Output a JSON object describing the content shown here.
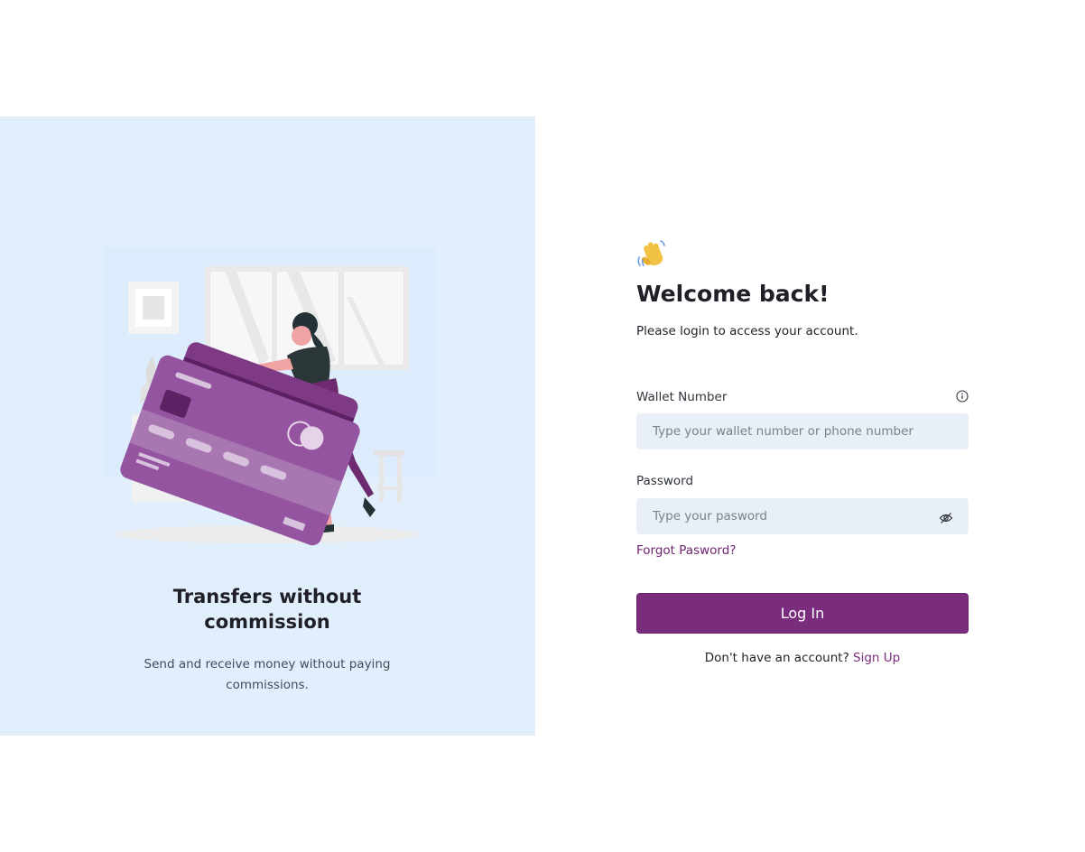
{
  "promo": {
    "title_line1": "Transfers without",
    "title_line2": "commission",
    "text_line1": "Send and receive money without paying",
    "text_line2": "commissions."
  },
  "login": {
    "icon": "waving-hand-icon",
    "title": "Welcome back!",
    "subtitle": "Please login to access your account.",
    "wallet_label": "Wallet Number",
    "wallet_placeholder": "Type your wallet number or phone number",
    "wallet_value": "",
    "password_label": "Password",
    "password_placeholder": "Type your pasword",
    "password_value": "",
    "forgot_label": "Forgot Pasword?",
    "login_button": "Log In",
    "signup_prompt": "Don't have an account?",
    "signup_link": "Sign Up"
  },
  "icons": {
    "info": "info-icon",
    "password_toggle": "eye-slash-icon",
    "illustration": "woman-with-credit-cards-illustration"
  },
  "colors": {
    "accent": "#7b2d7d",
    "left_panel_bg": "#e1effd",
    "input_bg": "#e9eff7"
  }
}
